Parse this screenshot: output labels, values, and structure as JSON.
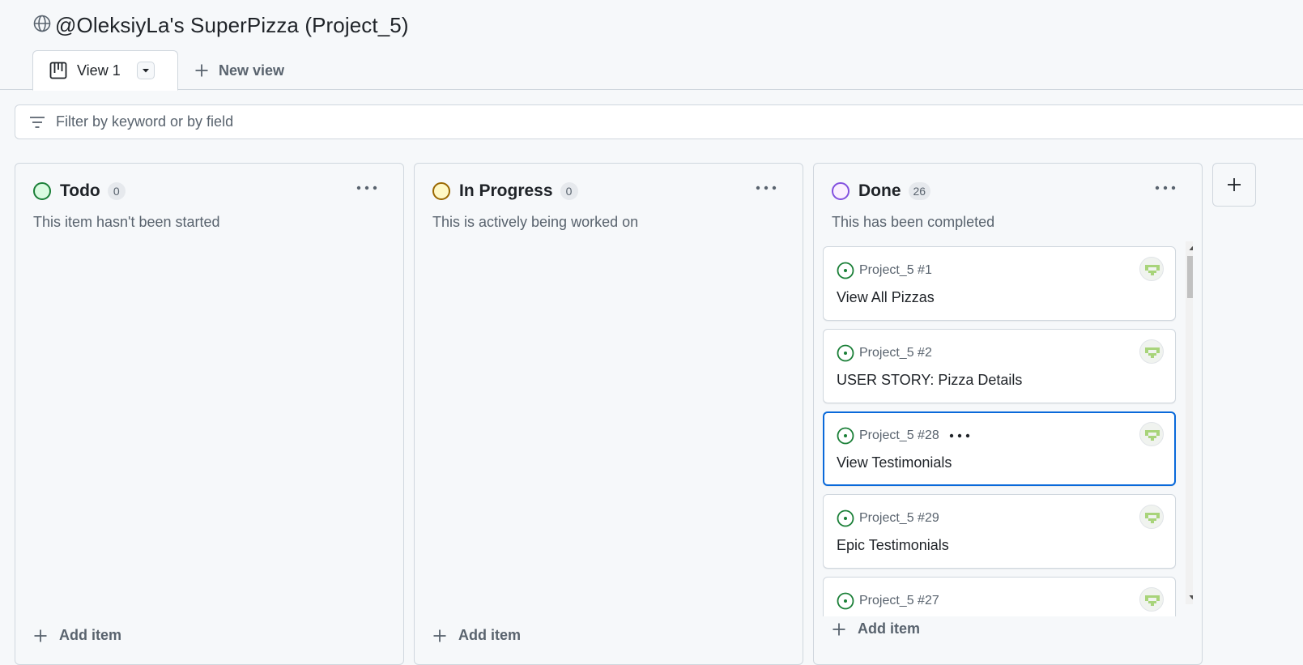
{
  "project": {
    "title": "@OleksiyLa's SuperPizza (Project_5)"
  },
  "tabs": {
    "active_label": "View 1",
    "new_view_label": "New view"
  },
  "filter": {
    "placeholder": "Filter by keyword or by field"
  },
  "columns": [
    {
      "name": "Todo",
      "count": "0",
      "description": "This item hasn't been started",
      "add_label": "Add item",
      "color": "#1a7f37",
      "fill": "#dafbe1"
    },
    {
      "name": "In Progress",
      "count": "0",
      "description": "This is actively being worked on",
      "add_label": "Add item",
      "color": "#9a6700",
      "fill": "#fff8c5"
    },
    {
      "name": "Done",
      "count": "26",
      "description": "This has been completed",
      "add_label": "Add item",
      "color": "#8250df",
      "fill": "#fbefff"
    }
  ],
  "cards": [
    {
      "ref": "Project_5 #1",
      "title": "View All Pizzas"
    },
    {
      "ref": "Project_5 #2",
      "title": "USER STORY: Pizza Details"
    },
    {
      "ref": "Project_5 #28",
      "title": "View Testimonials"
    },
    {
      "ref": "Project_5 #29",
      "title": "Epic Testimonials"
    },
    {
      "ref": "Project_5 #27",
      "title": ""
    }
  ],
  "colors": {
    "accent": "#0969da",
    "border": "#d0d7de",
    "muted": "#59636e",
    "issue_open": "#1a7f37"
  }
}
